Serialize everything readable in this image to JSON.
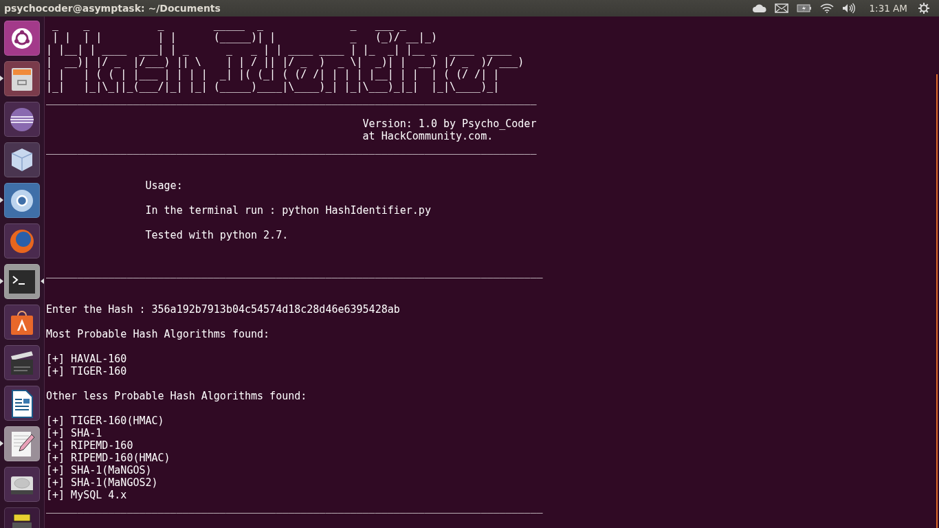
{
  "top_bar": {
    "title": "psychocoder@asymptask: ~/Documents",
    "time": "1:31 AM"
  },
  "launcher": [
    {
      "kind": "ubuntu",
      "running": false,
      "focused": false
    },
    {
      "kind": "files",
      "running": true,
      "focused": false
    },
    {
      "kind": "sphere",
      "running": false,
      "focused": false
    },
    {
      "kind": "cube",
      "running": false,
      "focused": false
    },
    {
      "kind": "chrome",
      "running": true,
      "focused": false
    },
    {
      "kind": "firefox",
      "running": false,
      "focused": false
    },
    {
      "kind": "terminal",
      "running": true,
      "focused": true
    },
    {
      "kind": "bag",
      "running": false,
      "focused": false
    },
    {
      "kind": "clapper",
      "running": false,
      "focused": false
    },
    {
      "kind": "writer",
      "running": false,
      "focused": false
    },
    {
      "kind": "editor",
      "running": true,
      "focused": false
    },
    {
      "kind": "disk",
      "running": false,
      "focused": false
    },
    {
      "kind": "stack",
      "running": false,
      "focused": false
    }
  ],
  "terminal": {
    "blocks": [
      {
        "lines": [
          " _    _           _        _____  _              _   ___ _",
          " | |  | |         | |      (_____)| |            _   (_)/ __|_)",
          "| |__| | ____  ___| | _      _   _ | | ____ ____ | |_  _| |__ _  ____  ____",
          "|  __)| |/ _  |/___) || \\    | | / || |/ _  )  _ \\|  _)| |  __) |/ _  )/ ___)",
          "| |   | ( ( | |___ | | | |  _| |( (_| ( (/ /| | | | |__| | |  | ( (/ /| |",
          "|_|   |_|\\_||_(___/|_| |_| (_____)____|\\____)_| |_|\\___)_|_|  |_|\\____)_|",
          "_______________________________________________________________________________"
        ]
      },
      {
        "lines": [
          "                                                   Version: 1.0 by Psycho_Coder",
          "                                                   at HackCommunity.com.",
          "_______________________________________________________________________________"
        ]
      },
      {
        "lines": [
          "                Usage:"
        ]
      },
      {
        "lines": [
          "                In the terminal run : python HashIdentifier.py"
        ]
      },
      {
        "lines": [
          "                Tested with python 2.7."
        ]
      },
      {
        "lines": [
          "________________________________________________________________________________"
        ]
      },
      {
        "lines": [
          "Enter the Hash : 356a192b7913b04c54574d18c28d46e6395428ab"
        ]
      },
      {
        "lines": [
          "Most Probable Hash Algorithms found:"
        ]
      },
      {
        "lines": [
          "[+] HAVAL-160",
          "[+] TIGER-160"
        ]
      },
      {
        "lines": [
          "Other less Probable Hash Algorithms found:"
        ]
      },
      {
        "lines": [
          "[+] TIGER-160(HMAC)",
          "[+] SHA-1",
          "[+] RIPEMD-160",
          "[+] RIPEMD-160(HMAC)",
          "[+] SHA-1(MaNGOS)",
          "[+] SHA-1(MaNGOS2)",
          "[+] MySQL 4.x",
          "________________________________________________________________________________"
        ]
      }
    ]
  }
}
